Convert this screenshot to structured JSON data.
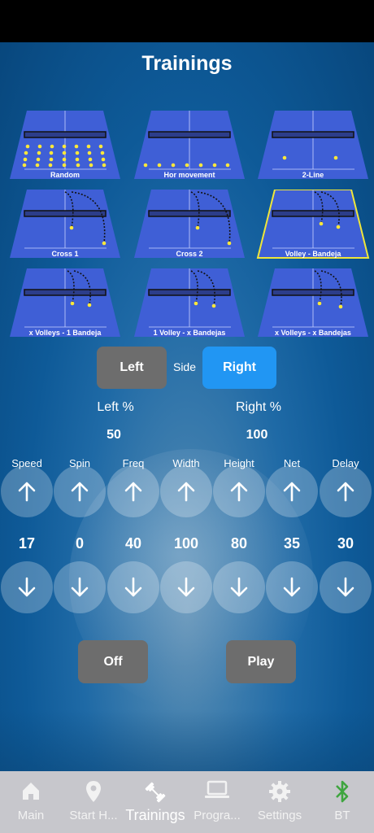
{
  "screen": {
    "title": "Trainings"
  },
  "trainings": [
    {
      "label": "Random",
      "selected": false
    },
    {
      "label": "Hor movement",
      "selected": false
    },
    {
      "label": "2-Line",
      "selected": false
    },
    {
      "label": "Cross 1",
      "selected": false
    },
    {
      "label": "Cross 2",
      "selected": false
    },
    {
      "label": "Volley - Bandeja",
      "selected": true
    },
    {
      "label": "x Volleys - 1 Bandeja",
      "selected": false
    },
    {
      "label": "1 Volley - x Bandejas",
      "selected": false
    },
    {
      "label": "x Volleys - x Bandejas",
      "selected": false
    }
  ],
  "side": {
    "left_label": "Left",
    "side_label": "Side",
    "right_label": "Right",
    "selected": "Right"
  },
  "percent": {
    "left_label": "Left %",
    "right_label": "Right %",
    "left_value": "50",
    "right_value": "100"
  },
  "params": [
    {
      "name": "Speed",
      "value": "17"
    },
    {
      "name": "Spin",
      "value": "0"
    },
    {
      "name": "Freq",
      "value": "40"
    },
    {
      "name": "Width",
      "value": "100"
    },
    {
      "name": "Height",
      "value": "80"
    },
    {
      "name": "Net",
      "value": "35"
    },
    {
      "name": "Delay",
      "value": "30"
    }
  ],
  "actions": {
    "off_label": "Off",
    "play_label": "Play"
  },
  "nav": [
    {
      "label": "Main",
      "icon": "home-icon"
    },
    {
      "label": "Start H...",
      "icon": "location-pin-icon"
    },
    {
      "label": "Trainings",
      "icon": "dumbbell-icon",
      "active": true
    },
    {
      "label": "Progra...",
      "icon": "laptop-icon"
    },
    {
      "label": "Settings",
      "icon": "gear-icon"
    },
    {
      "label": "BT",
      "icon": "bluetooth-icon"
    }
  ],
  "colors": {
    "court": "#3f5fd6",
    "selected_outline": "#f0e63a",
    "accent": "#2196f3",
    "button_gray": "#6d6d6d",
    "bt_green": "#3fa53f"
  }
}
